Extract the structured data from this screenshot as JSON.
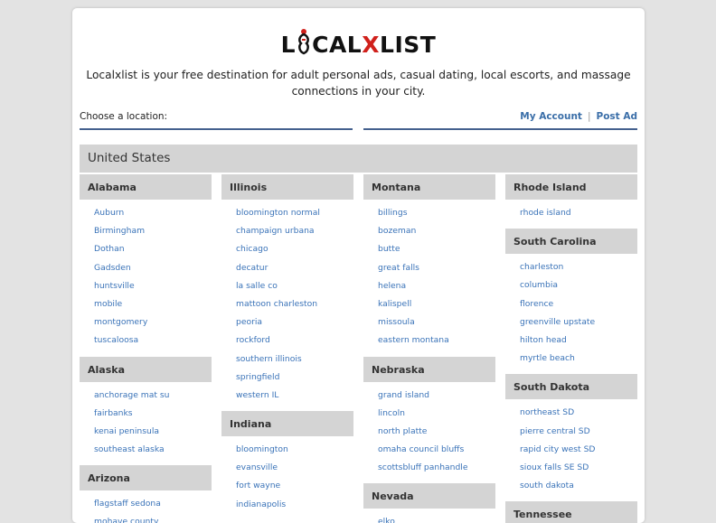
{
  "brand": {
    "logo_before": "L",
    "logo_mid": "CAL",
    "logo_x": "X",
    "logo_after": "LIST"
  },
  "tagline": "Localxlist is your free destination for adult personal ads, casual dating, local escorts, and massage connections in your city.",
  "location": {
    "label": "Choose a location:",
    "my_account": "My Account",
    "separator": "|",
    "post_ad": "Post Ad"
  },
  "country": "United States",
  "columns": [
    {
      "states": [
        {
          "name": "Alabama",
          "cities": [
            "Auburn",
            "Birmingham",
            "Dothan",
            "Gadsden",
            "huntsville",
            "mobile",
            "montgomery",
            "tuscaloosa"
          ]
        },
        {
          "name": "Alaska",
          "cities": [
            "anchorage mat su",
            "fairbanks",
            "kenai peninsula",
            "southeast alaska"
          ]
        },
        {
          "name": "Arizona",
          "cities": [
            "flagstaff sedona",
            "mohave county"
          ]
        }
      ]
    },
    {
      "states": [
        {
          "name": "Illinois",
          "cities": [
            "bloomington normal",
            "champaign urbana",
            "chicago",
            "decatur",
            "la salle co",
            "mattoon charleston",
            "peoria",
            "rockford",
            "southern illinois",
            "springfield",
            "western IL"
          ]
        },
        {
          "name": "Indiana",
          "cities": [
            "bloomington",
            "evansville",
            "fort wayne",
            "indianapolis"
          ]
        }
      ]
    },
    {
      "states": [
        {
          "name": "Montana",
          "cities": [
            "billings",
            "bozeman",
            "butte",
            "great falls",
            "helena",
            "kalispell",
            "missoula",
            "eastern montana"
          ]
        },
        {
          "name": "Nebraska",
          "cities": [
            "grand island",
            "lincoln",
            "north platte",
            "omaha council bluffs",
            "scottsbluff panhandle"
          ]
        },
        {
          "name": "Nevada",
          "cities": [
            "elko"
          ]
        }
      ]
    },
    {
      "states": [
        {
          "name": "Rhode Island",
          "cities": [
            "rhode island"
          ]
        },
        {
          "name": "South Carolina",
          "cities": [
            "charleston",
            "columbia",
            "florence",
            "greenville upstate",
            "hilton head",
            "myrtle beach"
          ]
        },
        {
          "name": "South Dakota",
          "cities": [
            "northeast SD",
            "pierre central SD",
            "rapid city west SD",
            "sioux falls SE SD",
            "south dakota"
          ]
        },
        {
          "name": "Tennessee",
          "cities": []
        }
      ]
    }
  ],
  "colors": {
    "link": "#3a73b8",
    "accent_line": "#44608e",
    "header_bg": "#d4d4d4",
    "logo_red": "#d0211c"
  }
}
